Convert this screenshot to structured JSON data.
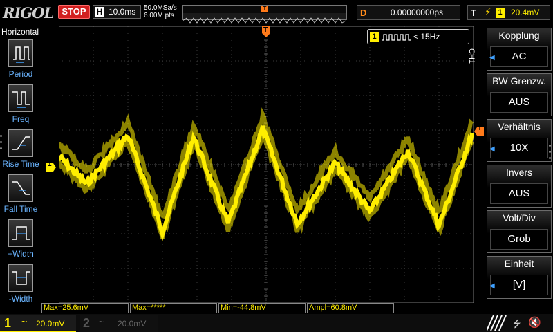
{
  "top": {
    "logo": "RIGOL",
    "run_state": "STOP",
    "timebase_letter": "H",
    "timebase": "10.0ms",
    "sample_rate": "50.0MSa/s",
    "memory_depth": "6.00M pts",
    "trigger_pos_marker": "T",
    "delay_letter": "D",
    "delay_value": "0.00000000ps",
    "trigger_letter": "T",
    "trigger_edge_icon": "rising-edge-icon",
    "trigger_source": "1",
    "trigger_level": "20.4mV"
  },
  "left_menu": {
    "title": "Horizontal",
    "items": [
      {
        "label": "Period"
      },
      {
        "label": "Freq"
      },
      {
        "label": "Rise Time"
      },
      {
        "label": "Fall Time"
      },
      {
        "label": "+Width"
      },
      {
        "label": "-Width"
      }
    ]
  },
  "screen": {
    "freq_counter_channel": "1",
    "freq_counter_value": "< 15Hz",
    "trigger_marker": "T",
    "channel_marker": "1",
    "trigger_level_marker": "T"
  },
  "right_menu": {
    "channel_tag": "CH1",
    "items": [
      {
        "title": "Kopplung",
        "value": "AC"
      },
      {
        "title": "BW Grenzw.",
        "value": "AUS"
      },
      {
        "title": "Verhältnis",
        "value": "10X"
      },
      {
        "title": "Invers",
        "value": "AUS"
      },
      {
        "title": "Volt/Div",
        "value": "Grob"
      },
      {
        "title": "Einheit",
        "value": "[V]"
      }
    ]
  },
  "measurements": [
    {
      "label": "Max=25.6mV"
    },
    {
      "label": "Max=*****"
    },
    {
      "label": "Min=-44.8mV"
    },
    {
      "label": "Ampl=60.8mV"
    }
  ],
  "bottom": {
    "ch1_num": "1",
    "ch1_coupling_icon": "~",
    "ch1_scale": "20.0mV",
    "ch2_num": "2",
    "ch2_coupling_icon": "~",
    "ch2_scale": "20.0mV"
  },
  "colors": {
    "ch1": "#ffee00",
    "trigger": "#ff7a1a",
    "stop": "#d21f1f",
    "menu_label": "#6ab4ff"
  }
}
